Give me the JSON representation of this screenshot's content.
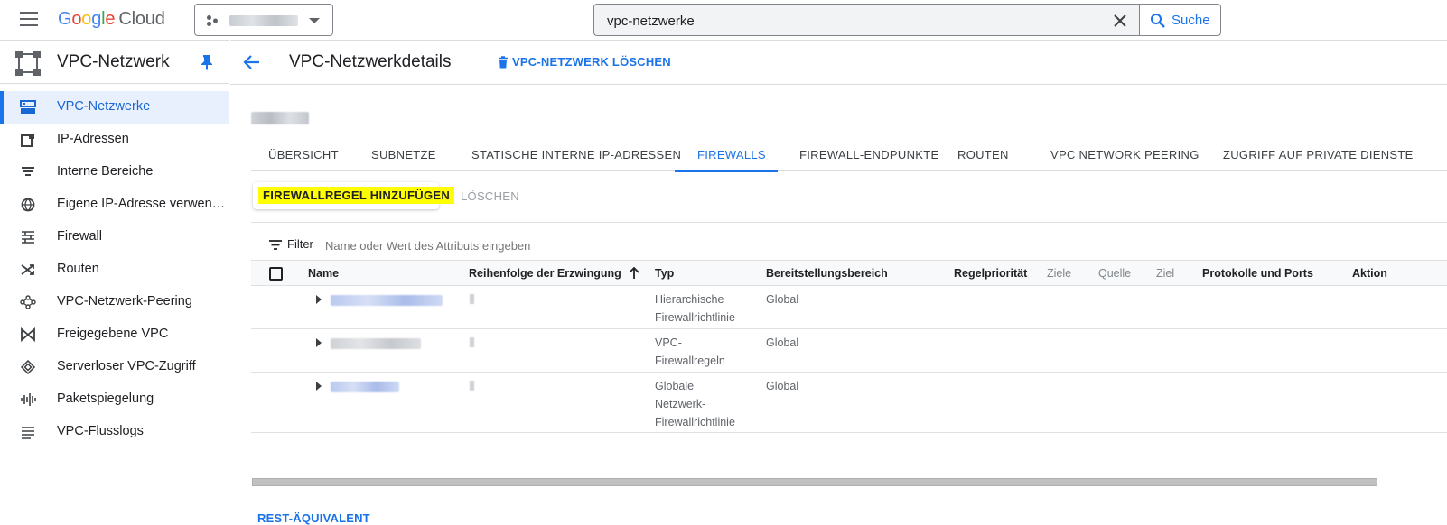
{
  "topbar": {
    "logo": {
      "g1": "G",
      "o1": "o",
      "o2": "o",
      "g2": "g",
      "l": "l",
      "e": "e",
      "cloud": "Cloud"
    },
    "search": {
      "value": "vpc-netzwerke",
      "button_label": "Suche"
    }
  },
  "sidenav": {
    "product_title": "VPC-Netzwerk",
    "items": [
      {
        "label": "VPC-Netzwerke",
        "icon": "vpc-networks-icon",
        "active": true
      },
      {
        "label": "IP-Adressen",
        "icon": "ip-address-icon"
      },
      {
        "label": "Interne Bereiche",
        "icon": "internal-ranges-icon"
      },
      {
        "label": "Eigene IP-Adresse verwen…",
        "icon": "globe-icon"
      },
      {
        "label": "Firewall",
        "icon": "firewall-icon"
      },
      {
        "label": "Routen",
        "icon": "routes-icon"
      },
      {
        "label": "VPC-Netzwerk-Peering",
        "icon": "peering-icon"
      },
      {
        "label": "Freigegebene VPC",
        "icon": "shared-vpc-icon"
      },
      {
        "label": "Serverloser VPC-Zugriff",
        "icon": "serverless-icon"
      },
      {
        "label": "Paketspiegelung",
        "icon": "packet-mirroring-icon"
      },
      {
        "label": "VPC-Flusslogs",
        "icon": "flow-logs-icon"
      }
    ]
  },
  "main": {
    "page_title": "VPC-Netzwerkdetails",
    "delete_network_label": "VPC-NETZWERK LÖSCHEN",
    "tabs": [
      {
        "label": "ÜBERSICHT"
      },
      {
        "label": "SUBNETZE"
      },
      {
        "label": "STATISCHE INTERNE IP-ADRESSEN"
      },
      {
        "label": "FIREWALLS",
        "active": true
      },
      {
        "label": "FIREWALL-ENDPUNKTE"
      },
      {
        "label": "ROUTEN"
      },
      {
        "label": "VPC NETWORK PEERING"
      },
      {
        "label": "ZUGRIFF AUF PRIVATE DIENSTE"
      }
    ],
    "add_rule_label": "FIREWALLREGEL HINZUFÜGEN",
    "delete_label": "LÖSCHEN",
    "filter": {
      "label": "Filter",
      "placeholder": "Name oder Wert des Attributs eingeben"
    },
    "table": {
      "columns": [
        "Name",
        "Reihenfolge der Erzwingung",
        "Typ",
        "Bereitstellungsbereich",
        "Regelpriorität",
        "Ziele",
        "Quelle",
        "Ziel",
        "Protokolle und Ports",
        "Aktion"
      ],
      "rows": [
        {
          "typ": "Hierarchische Firewallrichtlinie",
          "scope": "Global"
        },
        {
          "typ": "VPC-Firewallregeln",
          "scope": "Global"
        },
        {
          "typ": "Globale Netzwerk-Firewallrichtlinie",
          "scope": "Global"
        }
      ]
    },
    "rest_label": "REST-ÄQUIVALENT"
  },
  "colors": {
    "accent": "#1a73e8",
    "highlight": "#ffff00",
    "active_nav_bg": "#e8f0fe"
  }
}
